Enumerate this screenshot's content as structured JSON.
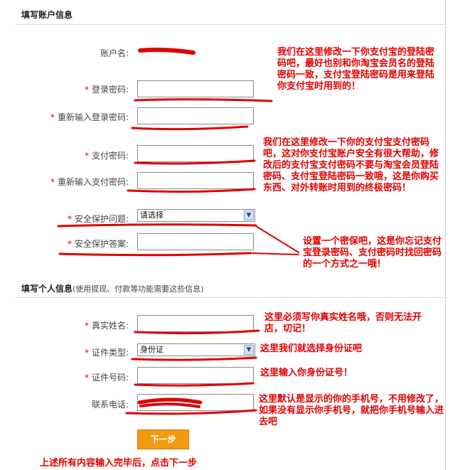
{
  "account_section": {
    "title": "填写账户信息",
    "account_name_label": "账户名:",
    "login_password_label": "登录密码:",
    "confirm_login_password_label": "重新输入登录密码:",
    "pay_password_label": "支付密码:",
    "confirm_pay_password_label": "重新输入支付密码:",
    "security_question_label": "安全保护问题:",
    "security_question_value": "请选择",
    "security_answer_label": "安全保护答案:"
  },
  "personal_section": {
    "title": "填写个人信息",
    "subtitle": "(使用提现、付款等功能需要这些信息)",
    "real_name_label": "真实姓名:",
    "id_type_label": "证件类型:",
    "id_type_value": "身份证",
    "id_number_label": "证件号码:",
    "phone_label": "联系电话:"
  },
  "required_mark": "*",
  "next_button_label": "下一步",
  "annotations": {
    "login_password_note": "我们在这里修改一下你支付宝的登陆密码吧，最好也别和你淘宝会员名的登陆密码一致，支付宝登陆密码是用来登陆你支付宝时用到的！",
    "pay_password_note": "我们在这里修改一下你的支付宝支付密码吧，这对你支付宝账户安全有很大帮助，修改后的支付宝支付密码不要与淘宝会员登陆密码、支付宝登陆密码一致哦，这是你购买东西、对外转账时用到的终极密码！",
    "security_note": "设置一个密保吧，这是你忘记支付宝登录密码、支付密码时找回密码的一个方式之一哦！",
    "real_name_note": "这里必须写你真实姓名哦，否则无法开店，切记！",
    "id_type_note": "这里我们就选择身份证吧",
    "id_number_note": "这里输入你身份证号！",
    "phone_note": "这里默认是显示的你的手机号，不用修改了，如果没有显示你手机号，就把你手机号输入进去吧",
    "footer_note": "上述所有内容输入完毕后，点击下一步"
  },
  "colors": {
    "annotation_red": "#e00000",
    "button_orange": "#f29a12",
    "required_red": "#dd0000"
  }
}
